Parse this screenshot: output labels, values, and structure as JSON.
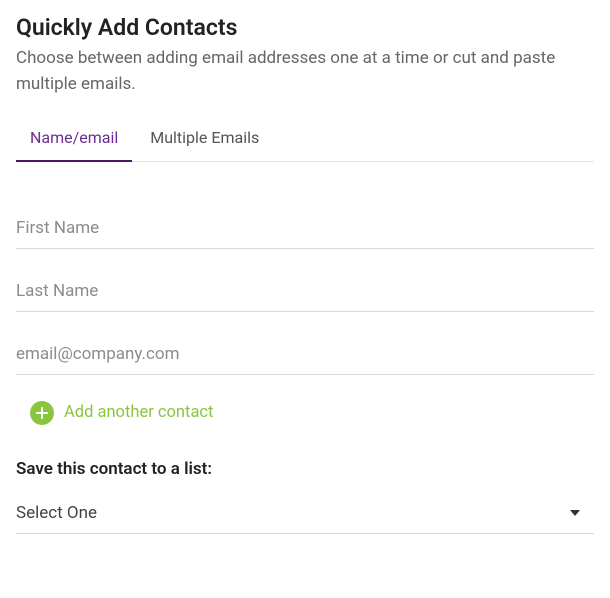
{
  "title": "Quickly Add Contacts",
  "subtitle": "Choose between adding email addresses one at a time or cut and paste multiple emails.",
  "tabs": {
    "name_email": "Name/email",
    "multiple": "Multiple Emails"
  },
  "fields": {
    "first_name": {
      "placeholder": "First Name",
      "value": ""
    },
    "last_name": {
      "placeholder": "Last Name",
      "value": ""
    },
    "email": {
      "placeholder": "email@company.com",
      "value": ""
    }
  },
  "add_contact_label": "Add another contact",
  "save_list_label": "Save this contact to a list:",
  "list_select": {
    "selected": "Select One"
  },
  "colors": {
    "accent_purple": "#6b2d8e",
    "accent_green": "#8bc53f"
  }
}
